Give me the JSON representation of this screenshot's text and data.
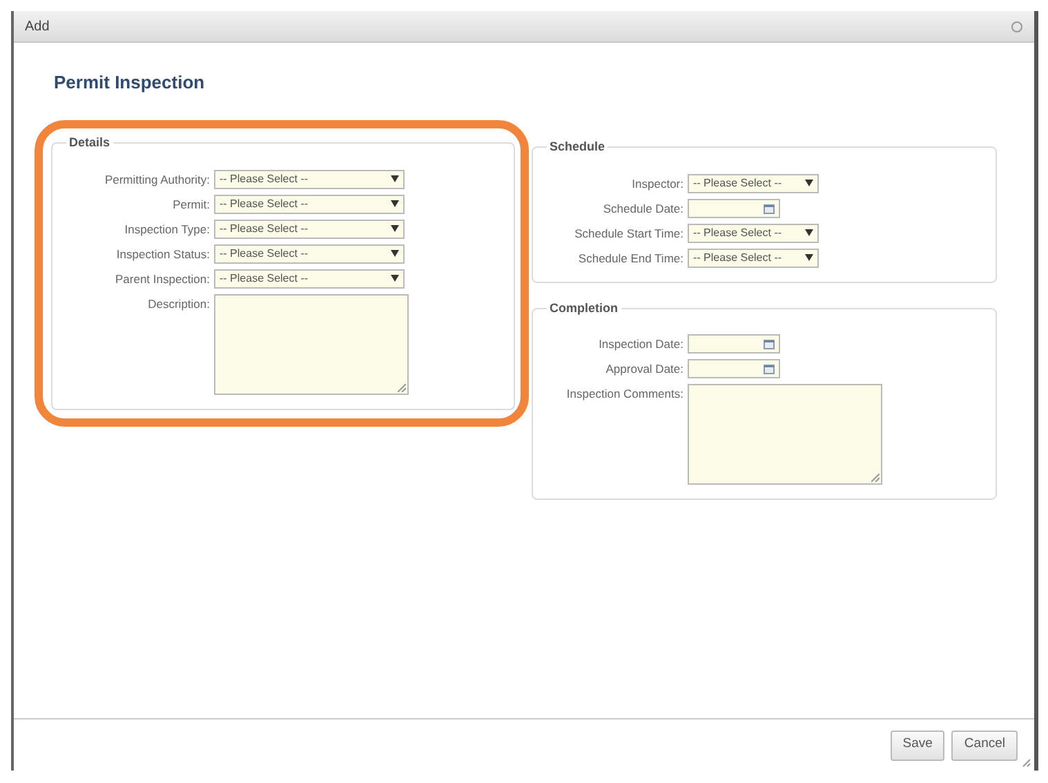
{
  "window": {
    "title": "Add"
  },
  "heading": "Permit Inspection",
  "sections": [
    {
      "title": "Details",
      "highlighted": true,
      "fields": [
        {
          "kind": "select",
          "label": "Permitting Authority:",
          "value": "-- Please Select --"
        },
        {
          "kind": "select",
          "label": "Permit:",
          "value": "-- Please Select --"
        },
        {
          "kind": "select",
          "label": "Inspection Type:",
          "value": "-- Please Select --"
        },
        {
          "kind": "select",
          "label": "Inspection Status:",
          "value": "-- Please Select --"
        },
        {
          "kind": "select",
          "label": "Parent Inspection:",
          "value": "-- Please Select --"
        },
        {
          "kind": "textarea",
          "label": "Description:"
        }
      ]
    },
    {
      "title": "Schedule",
      "highlighted": false,
      "fields": [
        {
          "kind": "select",
          "label": "Inspector:",
          "value": "-- Please Select --"
        },
        {
          "kind": "date",
          "label": "Schedule Date:"
        },
        {
          "kind": "select",
          "label": "Schedule Start Time:",
          "value": "-- Please Select --"
        },
        {
          "kind": "select",
          "label": "Schedule End Time:",
          "value": "-- Please Select --"
        }
      ]
    },
    {
      "title": "Completion",
      "highlighted": false,
      "fields": [
        {
          "kind": "date",
          "label": "Inspection Date:"
        },
        {
          "kind": "date",
          "label": "Approval Date:"
        },
        {
          "kind": "textarea",
          "label": "Inspection Comments:"
        }
      ]
    }
  ],
  "buttons": [
    "Save",
    "Cancel"
  ]
}
